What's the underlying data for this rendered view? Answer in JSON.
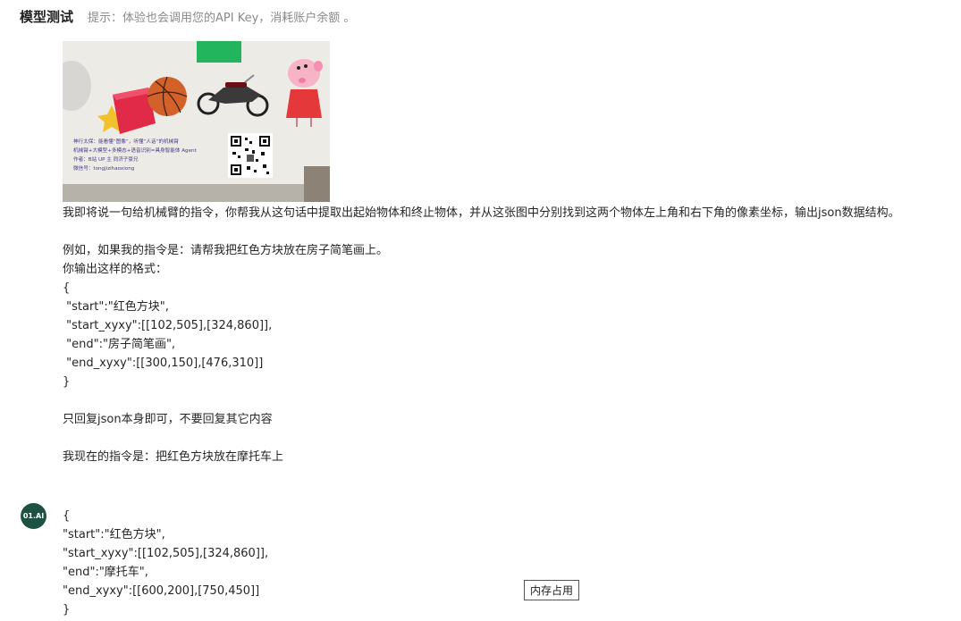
{
  "header": {
    "title": "模型测试",
    "hint": "提示：体验也会调用您的API Key，消耗账户余额 。"
  },
  "photo": {
    "caption_lines": [
      "神行太保：能看懂“图像”，听懂“人话”的机械臂",
      "机械臂+大模型+多模态+语音识别=具身智能体 Agent",
      "作者：B站 UP 主 同济子豪兄",
      "微信号：tongjizihaoxiong"
    ]
  },
  "user_message": {
    "lines": [
      "我即将说一句给机械臂的指令，你帮我从这句话中提取出起始物体和终止物体，并从这张图中分别找到这两个物体左上角和右下角的像素坐标，输出json数据结构。",
      "",
      "例如，如果我的指令是：请帮我把红色方块放在房子简笔画上。",
      "你输出这样的格式：",
      "{",
      " \"start\":\"红色方块\",",
      " \"start_xyxy\":[[102,505],[324,860]],",
      " \"end\":\"房子简笔画\",",
      " \"end_xyxy\":[[300,150],[476,310]]",
      "}",
      "",
      "只回复json本身即可，不要回复其它内容",
      "",
      "我现在的指令是：把红色方块放在摩托车上"
    ]
  },
  "assistant": {
    "avatar_label": "01.AI",
    "lines": [
      "{",
      "\"start\":\"红色方块\",",
      "\"start_xyxy\":[[102,505],[324,860]],",
      "\"end\":\"摩托车\",",
      "\"end_xyxy\":[[600,200],[750,450]]",
      "}"
    ]
  },
  "memory_button": {
    "label": "内存占用"
  }
}
